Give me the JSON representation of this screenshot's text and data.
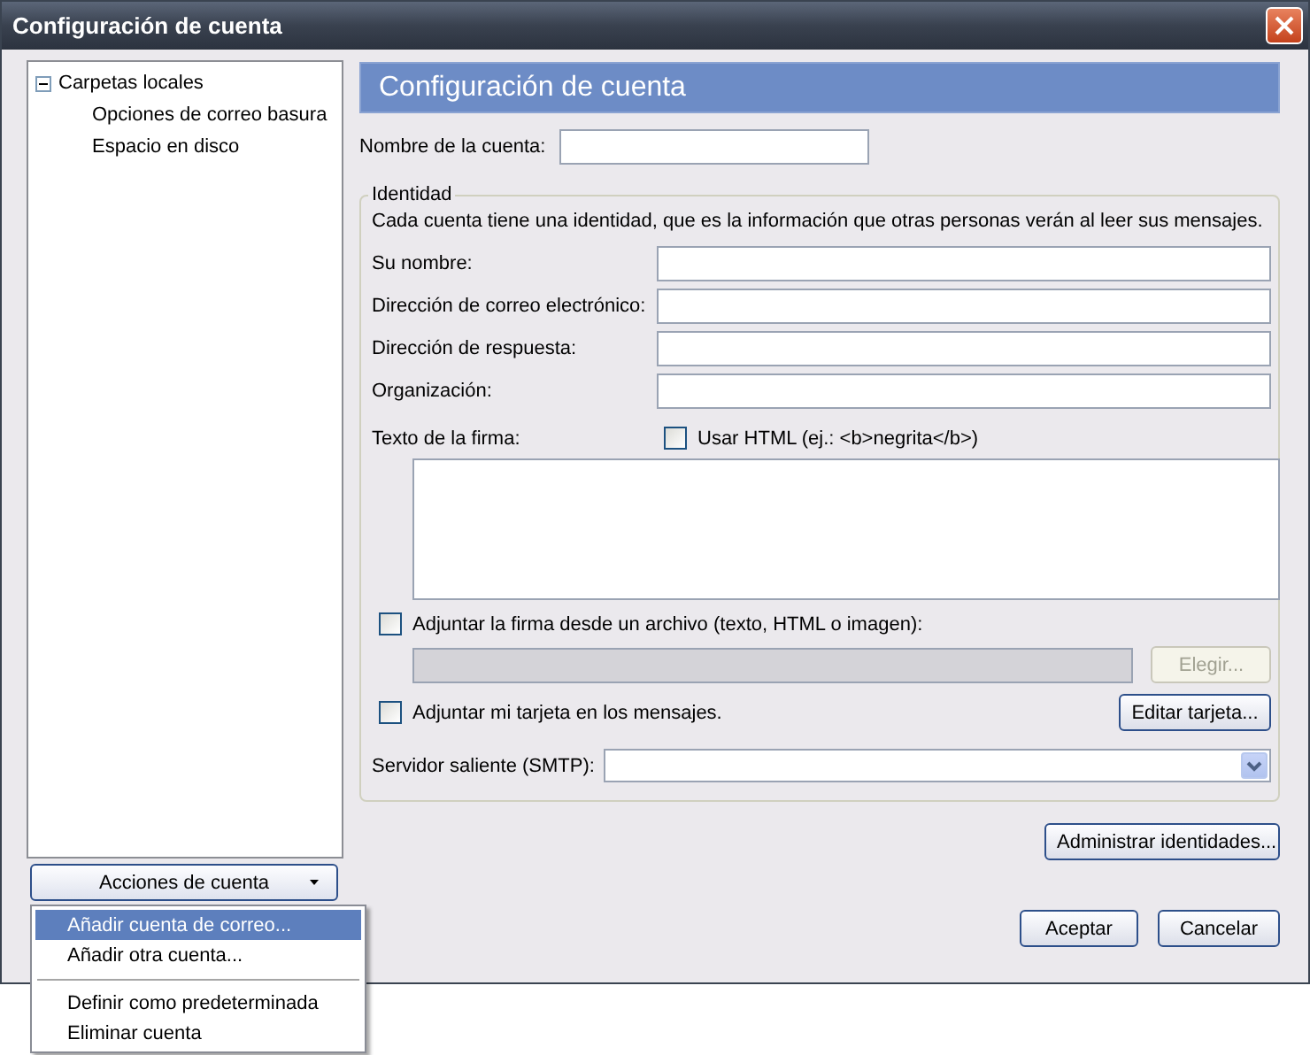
{
  "window": {
    "title": "Configuración de cuenta"
  },
  "tree": [
    {
      "label": "Carpetas locales",
      "expanded": true,
      "children": [
        {
          "label": "Opciones de correo basura"
        },
        {
          "label": "Espacio en disco"
        }
      ]
    }
  ],
  "account_actions": {
    "label": "Acciones de cuenta",
    "expanded": true,
    "menu": [
      {
        "kind": "item",
        "label": "Añadir cuenta de correo...",
        "selected": true
      },
      {
        "kind": "item",
        "label": "Añadir otra cuenta...",
        "selected": false
      },
      {
        "kind": "separator"
      },
      {
        "kind": "item",
        "label": "Definir como predeterminada",
        "selected": false
      },
      {
        "kind": "item",
        "label": "Eliminar cuenta",
        "selected": false
      }
    ]
  },
  "panel": {
    "title": "Configuración de cuenta",
    "account_name": {
      "label": "Nombre de la cuenta:"
    },
    "identity": {
      "legend": "Identidad",
      "description": "Cada cuenta tiene una identidad, que es la información que otras personas verán al leer sus mensajes.",
      "fields": [
        {
          "label": "Su nombre:"
        },
        {
          "label": "Dirección de correo electrónico:"
        },
        {
          "label": "Dirección de respuesta:"
        },
        {
          "label": "Organización:"
        }
      ],
      "signature": {
        "label": "Texto de la firma:",
        "use_html": {
          "label": "Usar HTML (ej.: <b>negrita</b>)",
          "checked": false
        }
      },
      "attach_file": {
        "label": "Adjuntar la firma desde un archivo (texto, HTML o imagen):",
        "checked": false
      },
      "file_path": {
        "disabled": true
      },
      "choose_button": {
        "label": "Elegir...",
        "disabled": true
      },
      "attach_card": {
        "label": "Adjuntar mi tarjeta en los mensajes.",
        "checked": false
      },
      "edit_card_button": {
        "label": "Editar tarjeta..."
      },
      "smtp": {
        "label": "Servidor saliente (SMTP):"
      }
    },
    "manage_identities_button": {
      "label": "Administrar identidades..."
    }
  },
  "buttons": [
    "Aceptar",
    "Cancelar"
  ]
}
